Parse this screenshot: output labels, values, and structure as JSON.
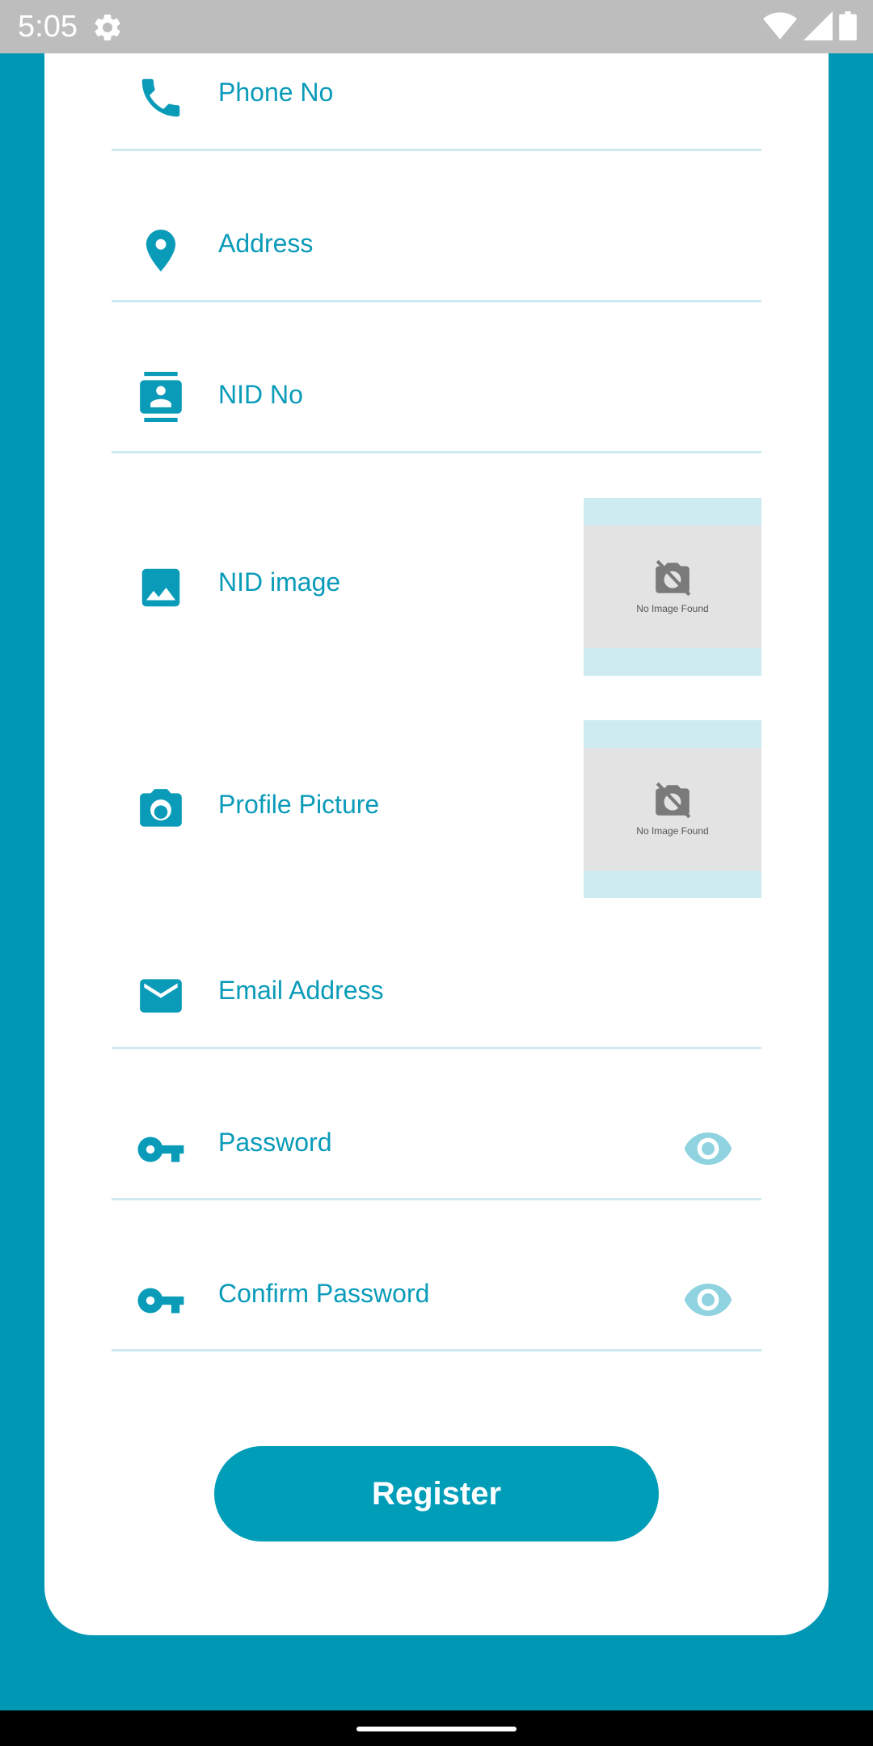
{
  "status_bar": {
    "time": "5:05",
    "icons": [
      "gear-icon",
      "wifi-icon",
      "signal-icon",
      "battery-icon"
    ]
  },
  "form": {
    "phone_label": "Phone No",
    "address_label": "Address",
    "nid_no_label": "NID No",
    "nid_image_label": "NID image",
    "profile_picture_label": "Profile Picture",
    "email_label": "Email Address",
    "password_label": "Password",
    "confirm_password_label": "Confirm Password",
    "no_image_text": "No Image Found",
    "register_label": "Register"
  },
  "colors": {
    "accent": "#0097b5",
    "label": "#0a9bb9",
    "eye": "#8fd3e0",
    "divider": "#cfe9f0"
  }
}
